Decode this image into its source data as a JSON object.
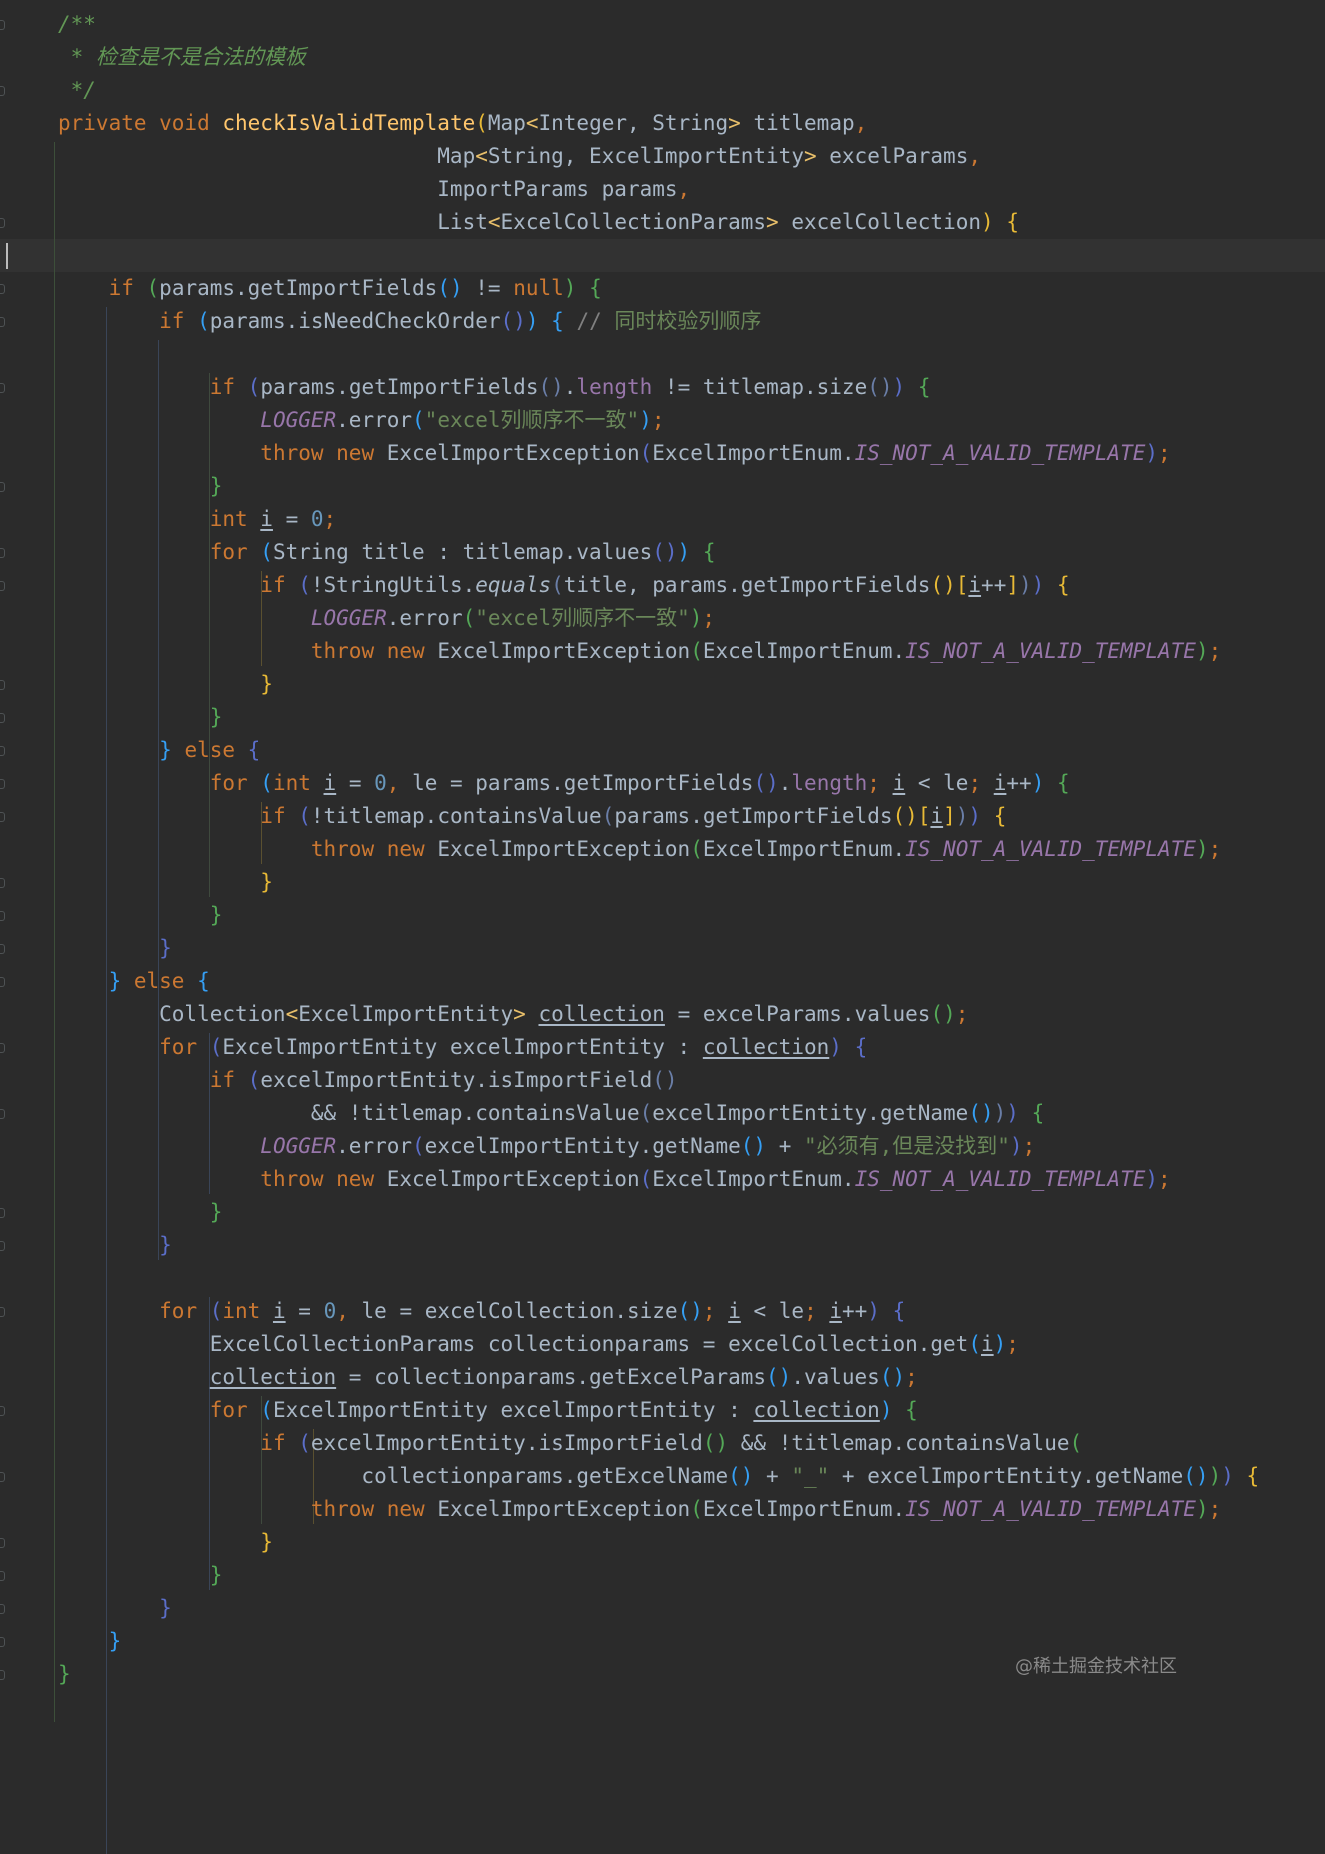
{
  "editor": {
    "theme": "dark",
    "colors": {
      "background": "#2b2b2b",
      "keyword": "#cc7832",
      "method": "#ffc66d",
      "string": "#6a8759",
      "comment": "#629755",
      "number": "#6897bb",
      "constant": "#9876aa",
      "text": "#a9b7c6"
    },
    "lines": [
      [
        {
          "t": "/**",
          "c": "c"
        }
      ],
      [
        {
          "t": " * 检查是不是合法的模板",
          "c": "c"
        }
      ],
      [
        {
          "t": " */",
          "c": "c"
        }
      ],
      [
        {
          "t": "private void ",
          "c": "k"
        },
        {
          "t": "checkIsValidTemplate",
          "c": "f"
        },
        {
          "t": "(",
          "c": "b1"
        },
        {
          "t": "Map"
        },
        {
          "t": "<",
          "c": "ang"
        },
        {
          "t": "Integer, String"
        },
        {
          "t": ">",
          "c": "ang"
        },
        {
          "t": " titlemap"
        },
        {
          "t": ",",
          "c": "k"
        }
      ],
      [
        {
          "t": "                              Map"
        },
        {
          "t": "<",
          "c": "ang"
        },
        {
          "t": "String, ExcelImportEntity"
        },
        {
          "t": ">",
          "c": "ang"
        },
        {
          "t": " excelParams"
        },
        {
          "t": ",",
          "c": "k"
        }
      ],
      [
        {
          "t": "                              ImportParams params"
        },
        {
          "t": ",",
          "c": "k"
        }
      ],
      [
        {
          "t": "                              List"
        },
        {
          "t": "<",
          "c": "ang"
        },
        {
          "t": "ExcelCollectionParams"
        },
        {
          "t": ">",
          "c": "ang"
        },
        {
          "t": " excelCollection"
        },
        {
          "t": ")",
          "c": "b1"
        },
        {
          "t": " "
        },
        {
          "t": "{",
          "c": "b1"
        }
      ],
      [],
      [
        {
          "t": "    "
        },
        {
          "t": "if ",
          "c": "k"
        },
        {
          "t": "(",
          "c": "b2"
        },
        {
          "t": "params.getImportFields"
        },
        {
          "t": "()",
          "c": "b3"
        },
        {
          "t": " != "
        },
        {
          "t": "null",
          "c": "k"
        },
        {
          "t": ")",
          "c": "b2"
        },
        {
          "t": " "
        },
        {
          "t": "{",
          "c": "b2"
        }
      ],
      [
        {
          "t": "        "
        },
        {
          "t": "if ",
          "c": "k"
        },
        {
          "t": "(",
          "c": "b3"
        },
        {
          "t": "params.isNeedCheckOrder"
        },
        {
          "t": "()",
          "c": "b4"
        },
        {
          "t": ")",
          "c": "b3"
        },
        {
          "t": " "
        },
        {
          "t": "{",
          "c": "b3"
        },
        {
          "t": " // ",
          "c": "lc"
        },
        {
          "t": "同时校验列顺序",
          "c": "lcz"
        }
      ],
      [],
      [
        {
          "t": "            "
        },
        {
          "t": "if ",
          "c": "k"
        },
        {
          "t": "(",
          "c": "b4"
        },
        {
          "t": "params.getImportFields"
        },
        {
          "t": "()",
          "c": "b5"
        },
        {
          "t": "."
        },
        {
          "t": "length",
          "c": "fld"
        },
        {
          "t": " != titlemap.size"
        },
        {
          "t": "()",
          "c": "b5"
        },
        {
          "t": ")",
          "c": "b4"
        },
        {
          "t": " "
        },
        {
          "t": "{",
          "c": "b2"
        }
      ],
      [
        {
          "t": "                "
        },
        {
          "t": "LOGGER",
          "c": "i"
        },
        {
          "t": ".error"
        },
        {
          "t": "(",
          "c": "b3"
        },
        {
          "t": "\"excel列顺序不一致\"",
          "c": "s"
        },
        {
          "t": ")",
          "c": "b3"
        },
        {
          "t": ";",
          "c": "k"
        }
      ],
      [
        {
          "t": "                "
        },
        {
          "t": "throw new ",
          "c": "k"
        },
        {
          "t": "ExcelImportException"
        },
        {
          "t": "(",
          "c": "b4"
        },
        {
          "t": "ExcelImportEnum."
        },
        {
          "t": "IS_NOT_A_VALID_TEMPLATE",
          "c": "i"
        },
        {
          "t": ")",
          "c": "b4"
        },
        {
          "t": ";",
          "c": "k"
        }
      ],
      [
        {
          "t": "            "
        },
        {
          "t": "}",
          "c": "b2"
        }
      ],
      [
        {
          "t": "            "
        },
        {
          "t": "int ",
          "c": "k"
        },
        {
          "t": "i",
          "c": "u"
        },
        {
          "t": " = "
        },
        {
          "t": "0",
          "c": "n"
        },
        {
          "t": ";",
          "c": "k"
        }
      ],
      [
        {
          "t": "            "
        },
        {
          "t": "for ",
          "c": "k"
        },
        {
          "t": "(",
          "c": "b3"
        },
        {
          "t": "String title : titlemap.values"
        },
        {
          "t": "()",
          "c": "b4"
        },
        {
          "t": ")",
          "c": "b3"
        },
        {
          "t": " "
        },
        {
          "t": "{",
          "c": "b2"
        }
      ],
      [
        {
          "t": "                "
        },
        {
          "t": "if ",
          "c": "k"
        },
        {
          "t": "(",
          "c": "b4"
        },
        {
          "t": "!StringUtils."
        },
        {
          "t": "equals",
          "c": "it"
        },
        {
          "t": "(",
          "c": "b5"
        },
        {
          "t": "title, params.getImportFields"
        },
        {
          "t": "()",
          "c": "b1"
        },
        {
          "t": "[",
          "c": "b1"
        },
        {
          "t": "i",
          "c": "u"
        },
        {
          "t": "++"
        },
        {
          "t": "]",
          "c": "b1"
        },
        {
          "t": ")",
          "c": "b5"
        },
        {
          "t": ")",
          "c": "b4"
        },
        {
          "t": " "
        },
        {
          "t": "{",
          "c": "b1"
        }
      ],
      [
        {
          "t": "                    "
        },
        {
          "t": "LOGGER",
          "c": "i"
        },
        {
          "t": ".error"
        },
        {
          "t": "(",
          "c": "b2"
        },
        {
          "t": "\"excel列顺序不一致\"",
          "c": "s"
        },
        {
          "t": ")",
          "c": "b2"
        },
        {
          "t": ";",
          "c": "k"
        }
      ],
      [
        {
          "t": "                    "
        },
        {
          "t": "throw new ",
          "c": "k"
        },
        {
          "t": "ExcelImportException"
        },
        {
          "t": "(",
          "c": "b2"
        },
        {
          "t": "ExcelImportEnum."
        },
        {
          "t": "IS_NOT_A_VALID_TEMPLATE",
          "c": "i"
        },
        {
          "t": ")",
          "c": "b2"
        },
        {
          "t": ";",
          "c": "k"
        }
      ],
      [
        {
          "t": "                "
        },
        {
          "t": "}",
          "c": "b1"
        }
      ],
      [
        {
          "t": "            "
        },
        {
          "t": "}",
          "c": "b2"
        }
      ],
      [
        {
          "t": "        "
        },
        {
          "t": "}",
          "c": "b3"
        },
        {
          "t": " else ",
          "c": "k"
        },
        {
          "t": "{",
          "c": "b4"
        }
      ],
      [
        {
          "t": "            "
        },
        {
          "t": "for ",
          "c": "k"
        },
        {
          "t": "(",
          "c": "b3"
        },
        {
          "t": "int ",
          "c": "k"
        },
        {
          "t": "i",
          "c": "u"
        },
        {
          "t": " = "
        },
        {
          "t": "0",
          "c": "n"
        },
        {
          "t": ", ",
          "c": "k"
        },
        {
          "t": "le = params.getImportFields"
        },
        {
          "t": "()",
          "c": "b4"
        },
        {
          "t": "."
        },
        {
          "t": "length",
          "c": "fld"
        },
        {
          "t": "; ",
          "c": "k"
        },
        {
          "t": "i",
          "c": "u"
        },
        {
          "t": " < le"
        },
        {
          "t": "; ",
          "c": "k"
        },
        {
          "t": "i",
          "c": "u"
        },
        {
          "t": "++"
        },
        {
          "t": ")",
          "c": "b3"
        },
        {
          "t": " "
        },
        {
          "t": "{",
          "c": "b2"
        }
      ],
      [
        {
          "t": "                "
        },
        {
          "t": "if ",
          "c": "k"
        },
        {
          "t": "(",
          "c": "b4"
        },
        {
          "t": "!titlemap.containsValue"
        },
        {
          "t": "(",
          "c": "b5"
        },
        {
          "t": "params.getImportFields"
        },
        {
          "t": "()",
          "c": "b1"
        },
        {
          "t": "[",
          "c": "b1"
        },
        {
          "t": "i",
          "c": "u"
        },
        {
          "t": "]",
          "c": "b1"
        },
        {
          "t": ")",
          "c": "b5"
        },
        {
          "t": ")",
          "c": "b4"
        },
        {
          "t": " "
        },
        {
          "t": "{",
          "c": "b1"
        }
      ],
      [
        {
          "t": "                    "
        },
        {
          "t": "throw new ",
          "c": "k"
        },
        {
          "t": "ExcelImportException"
        },
        {
          "t": "(",
          "c": "b2"
        },
        {
          "t": "ExcelImportEnum."
        },
        {
          "t": "IS_NOT_A_VALID_TEMPLATE",
          "c": "i"
        },
        {
          "t": ")",
          "c": "b2"
        },
        {
          "t": ";",
          "c": "k"
        }
      ],
      [
        {
          "t": "                "
        },
        {
          "t": "}",
          "c": "b1"
        }
      ],
      [
        {
          "t": "            "
        },
        {
          "t": "}",
          "c": "b2"
        }
      ],
      [
        {
          "t": "        "
        },
        {
          "t": "}",
          "c": "b4"
        }
      ],
      [
        {
          "t": "    "
        },
        {
          "t": "}",
          "c": "b3"
        },
        {
          "t": " else ",
          "c": "k"
        },
        {
          "t": "{",
          "c": "b3"
        }
      ],
      [
        {
          "t": "        Collection"
        },
        {
          "t": "<",
          "c": "ang"
        },
        {
          "t": "ExcelImportEntity"
        },
        {
          "t": ">",
          "c": "ang"
        },
        {
          "t": " "
        },
        {
          "t": "collection",
          "c": "u"
        },
        {
          "t": " = excelParams.values"
        },
        {
          "t": "()",
          "c": "b2"
        },
        {
          "t": ";",
          "c": "k"
        }
      ],
      [
        {
          "t": "        "
        },
        {
          "t": "for ",
          "c": "k"
        },
        {
          "t": "(",
          "c": "b4"
        },
        {
          "t": "ExcelImportEntity excelImportEntity : "
        },
        {
          "t": "collection",
          "c": "u"
        },
        {
          "t": ")",
          "c": "b4"
        },
        {
          "t": " "
        },
        {
          "t": "{",
          "c": "b4"
        }
      ],
      [
        {
          "t": "            "
        },
        {
          "t": "if ",
          "c": "k"
        },
        {
          "t": "(",
          "c": "b4"
        },
        {
          "t": "excelImportEntity.isImportField"
        },
        {
          "t": "()",
          "c": "b5"
        }
      ],
      [
        {
          "t": "                    && !titlemap.containsValue"
        },
        {
          "t": "(",
          "c": "b5"
        },
        {
          "t": "excelImportEntity.getName"
        },
        {
          "t": "()",
          "c": "b3"
        },
        {
          "t": ")",
          "c": "b5"
        },
        {
          "t": ")",
          "c": "b4"
        },
        {
          "t": " "
        },
        {
          "t": "{",
          "c": "b2"
        }
      ],
      [
        {
          "t": "                "
        },
        {
          "t": "LOGGER",
          "c": "i"
        },
        {
          "t": ".error"
        },
        {
          "t": "(",
          "c": "b4"
        },
        {
          "t": "excelImportEntity.getName"
        },
        {
          "t": "()",
          "c": "b3"
        },
        {
          "t": " + "
        },
        {
          "t": "\"必须有,但是没找到\"",
          "c": "s"
        },
        {
          "t": ")",
          "c": "b4"
        },
        {
          "t": ";",
          "c": "k"
        }
      ],
      [
        {
          "t": "                "
        },
        {
          "t": "throw new ",
          "c": "k"
        },
        {
          "t": "ExcelImportException"
        },
        {
          "t": "(",
          "c": "b4"
        },
        {
          "t": "ExcelImportEnum."
        },
        {
          "t": "IS_NOT_A_VALID_TEMPLATE",
          "c": "i"
        },
        {
          "t": ")",
          "c": "b4"
        },
        {
          "t": ";",
          "c": "k"
        }
      ],
      [
        {
          "t": "            "
        },
        {
          "t": "}",
          "c": "b2"
        }
      ],
      [
        {
          "t": "        "
        },
        {
          "t": "}",
          "c": "b4"
        }
      ],
      [],
      [
        {
          "t": "        "
        },
        {
          "t": "for ",
          "c": "k"
        },
        {
          "t": "(",
          "c": "b4"
        },
        {
          "t": "int ",
          "c": "k"
        },
        {
          "t": "i",
          "c": "u"
        },
        {
          "t": " = "
        },
        {
          "t": "0",
          "c": "n"
        },
        {
          "t": ", ",
          "c": "k"
        },
        {
          "t": "le = excelCollection.size"
        },
        {
          "t": "()",
          "c": "b3"
        },
        {
          "t": "; ",
          "c": "k"
        },
        {
          "t": "i",
          "c": "u"
        },
        {
          "t": " < le"
        },
        {
          "t": "; ",
          "c": "k"
        },
        {
          "t": "i",
          "c": "u"
        },
        {
          "t": "++"
        },
        {
          "t": ")",
          "c": "b4"
        },
        {
          "t": " "
        },
        {
          "t": "{",
          "c": "b4"
        }
      ],
      [
        {
          "t": "            ExcelCollectionParams collectionparams = excelCollection.get"
        },
        {
          "t": "(",
          "c": "b3"
        },
        {
          "t": "i",
          "c": "u"
        },
        {
          "t": ")",
          "c": "b3"
        },
        {
          "t": ";",
          "c": "k"
        }
      ],
      [
        {
          "t": "            "
        },
        {
          "t": "collection",
          "c": "u"
        },
        {
          "t": " = collectionparams.getExcelParams"
        },
        {
          "t": "()",
          "c": "b3"
        },
        {
          "t": ".values"
        },
        {
          "t": "()",
          "c": "b3"
        },
        {
          "t": ";",
          "c": "k"
        }
      ],
      [
        {
          "t": "            "
        },
        {
          "t": "for ",
          "c": "k"
        },
        {
          "t": "(",
          "c": "b3"
        },
        {
          "t": "ExcelImportEntity excelImportEntity : "
        },
        {
          "t": "collection",
          "c": "u"
        },
        {
          "t": ")",
          "c": "b3"
        },
        {
          "t": " "
        },
        {
          "t": "{",
          "c": "b2"
        }
      ],
      [
        {
          "t": "                "
        },
        {
          "t": "if ",
          "c": "k"
        },
        {
          "t": "(",
          "c": "b4"
        },
        {
          "t": "excelImportEntity.isImportField"
        },
        {
          "t": "()",
          "c": "b2"
        },
        {
          "t": " && !titlemap.containsValue"
        },
        {
          "t": "(",
          "c": "b2"
        }
      ],
      [
        {
          "t": "                        collectionparams.getExcelName"
        },
        {
          "t": "()",
          "c": "b3"
        },
        {
          "t": " + "
        },
        {
          "t": "\"_\"",
          "c": "s"
        },
        {
          "t": " + excelImportEntity.getName"
        },
        {
          "t": "()",
          "c": "b3"
        },
        {
          "t": ")",
          "c": "b2"
        },
        {
          "t": ")",
          "c": "b4"
        },
        {
          "t": " "
        },
        {
          "t": "{",
          "c": "b1"
        }
      ],
      [
        {
          "t": "                    "
        },
        {
          "t": "throw new ",
          "c": "k"
        },
        {
          "t": "ExcelImportException"
        },
        {
          "t": "(",
          "c": "b2"
        },
        {
          "t": "ExcelImportEnum."
        },
        {
          "t": "IS_NOT_A_VALID_TEMPLATE",
          "c": "i"
        },
        {
          "t": ")",
          "c": "b2"
        },
        {
          "t": ";",
          "c": "k"
        }
      ],
      [
        {
          "t": "                "
        },
        {
          "t": "}",
          "c": "b1"
        }
      ],
      [
        {
          "t": "            "
        },
        {
          "t": "}",
          "c": "b2"
        }
      ],
      [
        {
          "t": "        "
        },
        {
          "t": "}",
          "c": "b4"
        }
      ],
      [
        {
          "t": "    "
        },
        {
          "t": "}",
          "c": "b3"
        }
      ],
      [
        {
          "t": "}",
          "c": "b2"
        }
      ]
    ],
    "caret_line": 7
  },
  "watermark": "@稀土掘金技术社区"
}
